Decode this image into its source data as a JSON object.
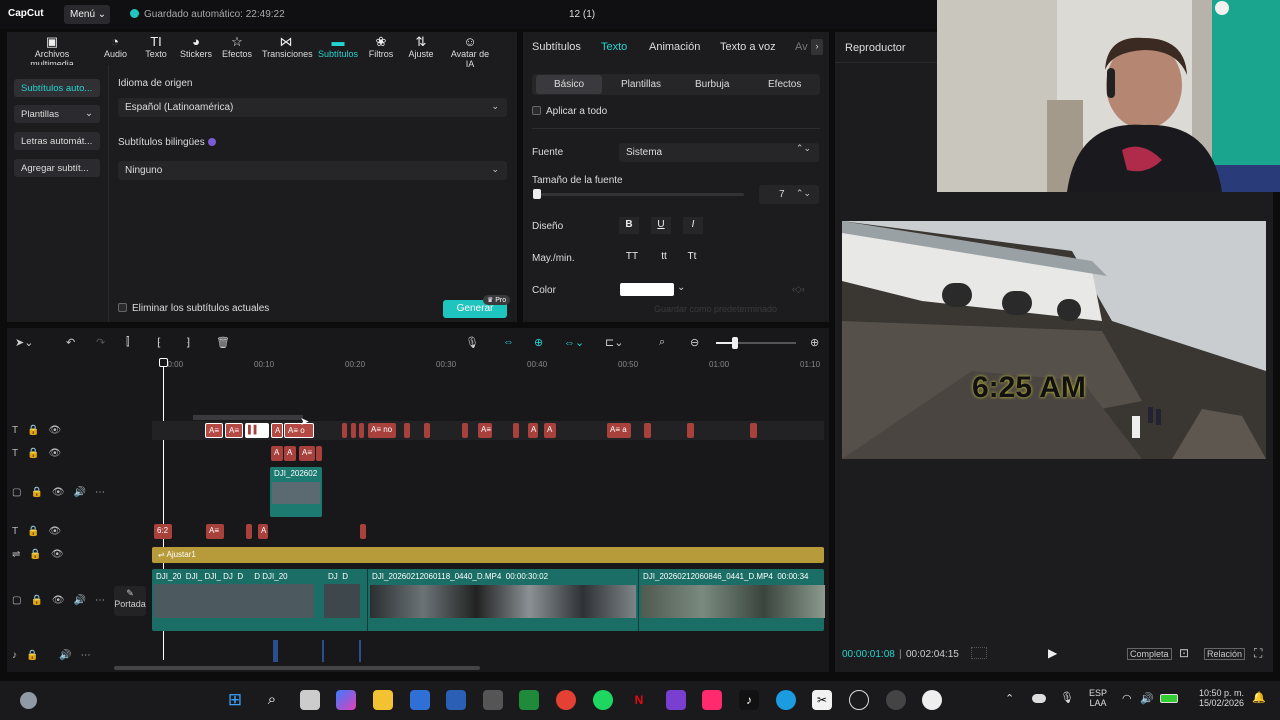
{
  "titlebar": {
    "logo": "CapCut",
    "menu": "Menú",
    "autosave": "Guardado automático: 22:49:22",
    "project": "12 (1)"
  },
  "toolbar": [
    {
      "label": "Archivos multimedia",
      "icon": "media-icon"
    },
    {
      "label": "Audio",
      "icon": "audio-icon"
    },
    {
      "label": "Texto",
      "icon": "text-icon"
    },
    {
      "label": "Stickers",
      "icon": "stickers-icon"
    },
    {
      "label": "Efectos",
      "icon": "effects-icon"
    },
    {
      "label": "Transiciones",
      "icon": "transitions-icon"
    },
    {
      "label": "Subtítulos",
      "icon": "subtitles-icon",
      "active": true
    },
    {
      "label": "Filtros",
      "icon": "filters-icon"
    },
    {
      "label": "Ajuste",
      "icon": "adjust-icon"
    },
    {
      "label": "Avatar de IA",
      "icon": "ai-avatar-icon"
    }
  ],
  "sidebar": [
    "Subtítulos auto...",
    "Plantillas",
    "Letras automát...",
    "Agregar subtít..."
  ],
  "subs": {
    "source_lang_label": "Idioma de origen",
    "source_lang": "Español (Latinoamérica)",
    "bilingual_label": "Subtítulos bilingües",
    "bilingual": "Ninguno",
    "clear_label": "Eliminar los subtítulos actuales",
    "generate": "Generar",
    "pro": "Pro"
  },
  "mid": {
    "tabs": [
      "Subtítulos",
      "Texto",
      "Animación",
      "Texto a voz",
      "Av"
    ],
    "subtabs": [
      "Básico",
      "Plantillas",
      "Burbuja",
      "Efectos"
    ],
    "apply_all": "Aplicar a todo",
    "font_label": "Fuente",
    "font": "Sistema",
    "size_label": "Tamaño de la fuente",
    "size": "7",
    "design_label": "Diseño",
    "case_label": "May./min.",
    "case_opts": [
      "TT",
      "tt",
      "Tt"
    ],
    "color_label": "Color",
    "save_default": "Guardar como predeterminado"
  },
  "player": {
    "title": "Reproductor",
    "current": "00:00:01:08",
    "total": "00:02:04:15",
    "full": "Completa",
    "ratio": "Relación",
    "overlay": "6:25 AM"
  },
  "timeline": {
    "ticks": [
      "00:00",
      "00:10",
      "00:20",
      "00:30",
      "00:40",
      "00:50",
      "01:00",
      "01:10"
    ],
    "adjust": "Ajustar1",
    "cover": "Portada",
    "clip_small": "DJI_202602",
    "clip_a": "DJI_20260212060118_0440_D.MP4",
    "clip_a_dur": "00:00:30:02",
    "clip_b": "DJI_20260212060846_0441_D.MP4",
    "clip_b_dur": "00:00:34",
    "track_texts": [
      "A≡",
      "A≡",
      "A≡ o",
      "A≡ no",
      "A≡",
      "A",
      "A≡ a"
    ]
  },
  "taskbar": {
    "lang": "ESP",
    "layout": "LAA",
    "time": "10:50 p. m.",
    "date": "15/02/2026"
  }
}
